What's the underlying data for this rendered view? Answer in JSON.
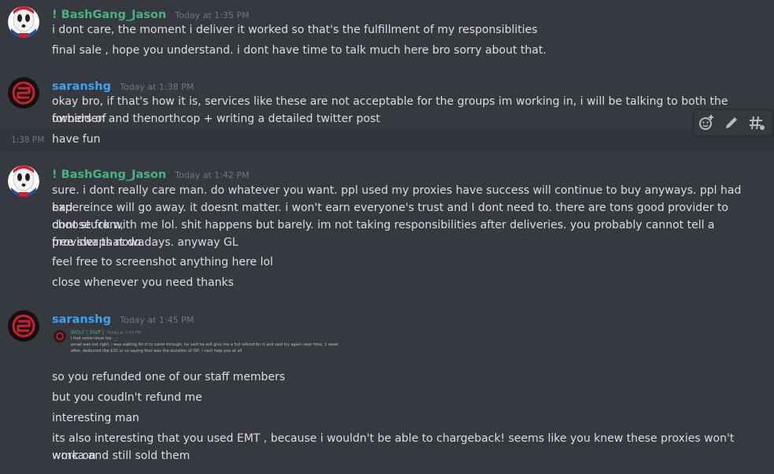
{
  "colors": {
    "bg": "#36393f",
    "green_user": "#43b581",
    "blue_user": "#3ba5f3",
    "muted": "#72767d"
  },
  "messages": [
    {
      "user": "! BashGang_Jason",
      "time": "Today at 1:35 PM",
      "lines": [
        "i dont care, the moment i deliver it worked so that's the fulfillment of my responsiblities",
        "final sale , hope you understand. i dont have time to talk much here bro sorry about that."
      ]
    },
    {
      "user": "saranshg",
      "time": "Today at 1:38 PM",
      "lines": [
        "okay bro, if that's how it is, services like these are not acceptable for the groups im working in, i will be talking to both the owners of",
        "forbidden and thenorthcop + writing a detailed twitter post"
      ],
      "followup": {
        "time": "1:38 PM",
        "text": "have fun"
      }
    },
    {
      "user": "! BashGang_Jason",
      "time": "Today at 1:42 PM",
      "lines": [
        "sure. i dont really care man. do whatever you want. ppl used my proxies have success will continue to buy anyways. ppl  had bad",
        "expereince will go away. it doesnt matter. i won't earn everyone's trust and I dont need to. there are tons good provider to choose from,",
        "dont stuck with me lol. shit happens but barely. im not taking responsibilities after deliveries. you probably cannot tell a provider that do",
        "free swaps nowadays. anyway GL",
        "feel free to screenshot anything here lol",
        "close whenever you need thanks"
      ]
    },
    {
      "user": "saranshg",
      "time": "Today at 1:45 PM",
      "embed": {
        "name": "WOLF [ Staff ]",
        "time": "Today at 1:43 PM",
        "lines": [
          "i had same issue too -_-",
          "email was not right, i was waiting for it to come through, he said he will give me a full refund for it and said try again next time, 1 week",
          "after, deducted like $10 or so saying that was the duration of ISP, i cant help you at all"
        ]
      },
      "lines": [
        "so you refunded one of our staff members",
        "but you coudln't refund me",
        "interesting man",
        "its also interesting that you used EMT , because i wouldn't be able to chargeback! seems like you knew these proxies won't work on",
        "wmca and still sold them"
      ]
    }
  ],
  "toolbar": {
    "icons": [
      "add-reaction-icon",
      "pencil-icon",
      "thread-icon"
    ]
  }
}
